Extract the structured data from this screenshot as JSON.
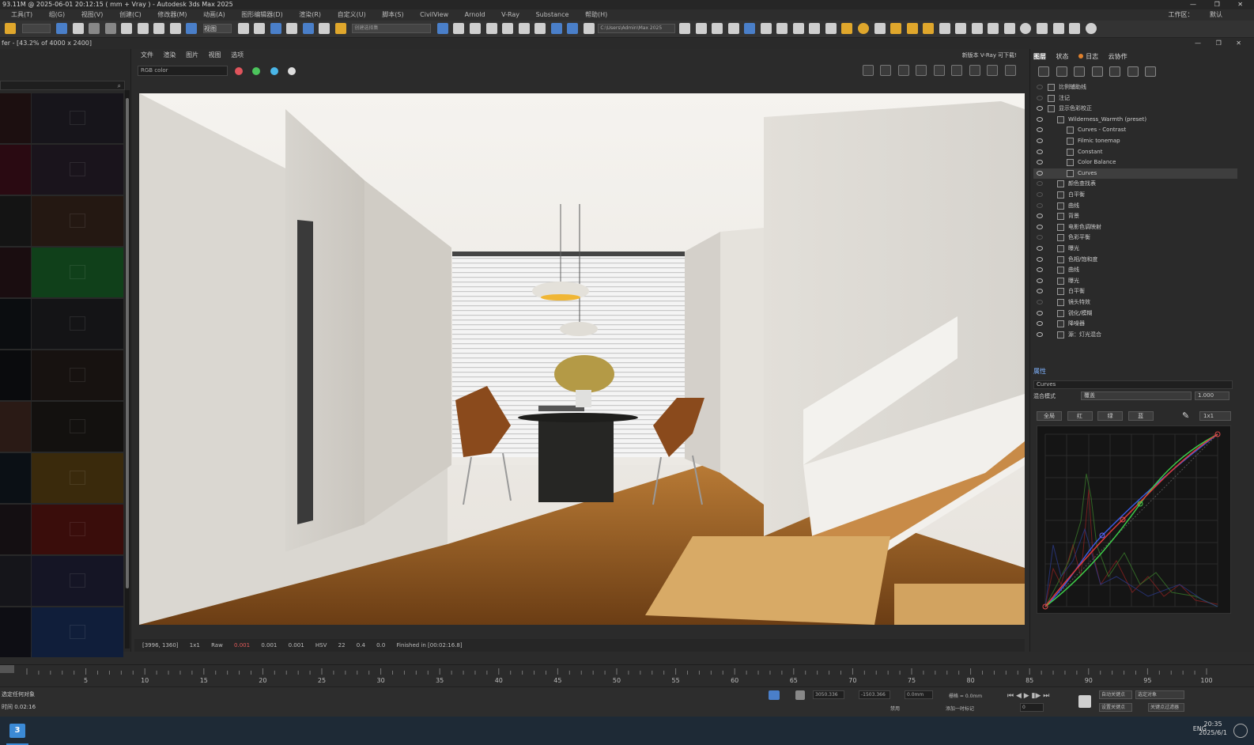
{
  "title": "93.11M @ 2025-06-01 20:12:15  ( mm + Vray ) - Autodesk 3ds Max 2025",
  "window_controls": "—  ❐  ✕",
  "menu": [
    "工具(T)",
    "组(G)",
    "视图(V)",
    "创建(C)",
    "修改器(M)",
    "动画(A)",
    "图形编辑器(D)",
    "渲染(R)",
    "自定义(U)",
    "脚本(S)",
    "CivilView",
    "Arnold",
    "V-Ray",
    "Substance",
    "帮助(H)"
  ],
  "menu_right": [
    "工作区：",
    "默认"
  ],
  "toolbar": {
    "view_dropdown": "视图",
    "selection_set": "创建选择集",
    "path": "C:\\Users\\Admin\\Max 2025"
  },
  "framebuffer_title": "fer - [43.2% of 4000 x 2400]",
  "framebuffer_window_controls": "—  ❐  ✕",
  "history_swatches": [
    {
      "a": "#1c0f10",
      "b": "#17151b"
    },
    {
      "a": "#2a0a12",
      "b": "#1a141c"
    },
    {
      "a": "#141414",
      "b": "#241812"
    },
    {
      "a": "#1a0d10",
      "b": "#10401a"
    },
    {
      "a": "#0b0d10",
      "b": "#141416"
    },
    {
      "a": "#0a0b0d",
      "b": "#171210"
    },
    {
      "a": "#2a1a15",
      "b": "#13110f"
    },
    {
      "a": "#0b1015",
      "b": "#3a2a0c"
    },
    {
      "a": "#140f12",
      "b": "#3a0d0b"
    },
    {
      "a": "#15151a",
      "b": "#151525"
    },
    {
      "a": "#0e0e14",
      "b": "#101e3a"
    }
  ],
  "vp_menu": [
    "文件",
    "渲染",
    "图片",
    "视图",
    "选项"
  ],
  "channel": "RGB color",
  "channel_dots": [
    "#e0545c",
    "#4cc45c",
    "#4ab6e8"
  ],
  "new_version": "新版本 V-Ray 可下载!",
  "status": {
    "coords": "[3996, 1360]",
    "zoom": "1x1",
    "raw": "Raw",
    "r": "0.001",
    "g": "0.001",
    "b": "0.001",
    "mode": "HSV",
    "h": "22",
    "s": "0.4",
    "v": "0.0",
    "finished": "Finished in [00:02:16.8]"
  },
  "right_tabs": [
    "图层",
    "状态",
    "日志",
    "云协作"
  ],
  "layers": [
    {
      "label": "比例辅助线",
      "indent": 0,
      "visible": false,
      "selected": false
    },
    {
      "label": "注记",
      "indent": 0,
      "visible": false,
      "selected": false
    },
    {
      "label": "显示色彩校正",
      "indent": 0,
      "visible": true,
      "selected": false
    },
    {
      "label": "Wilderness_Warmth (preset)",
      "indent": 1,
      "visible": true,
      "selected": false
    },
    {
      "label": "Curves - Contrast",
      "indent": 2,
      "visible": true,
      "selected": false
    },
    {
      "label": "Filmic tonemap",
      "indent": 2,
      "visible": true,
      "selected": false
    },
    {
      "label": "Constant",
      "indent": 2,
      "visible": true,
      "selected": false
    },
    {
      "label": "Color Balance",
      "indent": 2,
      "visible": true,
      "selected": false
    },
    {
      "label": "Curves",
      "indent": 2,
      "visible": true,
      "selected": true
    },
    {
      "label": "颜色查找表",
      "indent": 1,
      "visible": false,
      "selected": false
    },
    {
      "label": "白平衡",
      "indent": 1,
      "visible": false,
      "selected": false
    },
    {
      "label": "曲线",
      "indent": 1,
      "visible": false,
      "selected": false
    },
    {
      "label": "背景",
      "indent": 1,
      "visible": true,
      "selected": false
    },
    {
      "label": "电影色调映射",
      "indent": 1,
      "visible": true,
      "selected": false
    },
    {
      "label": "色彩平衡",
      "indent": 1,
      "visible": false,
      "selected": false
    },
    {
      "label": "曝光",
      "indent": 1,
      "visible": true,
      "selected": false
    },
    {
      "label": "色相/饱和度",
      "indent": 1,
      "visible": true,
      "selected": false
    },
    {
      "label": "曲线",
      "indent": 1,
      "visible": true,
      "selected": false
    },
    {
      "label": "曝光",
      "indent": 1,
      "visible": true,
      "selected": false
    },
    {
      "label": "白平衡",
      "indent": 1,
      "visible": true,
      "selected": false
    },
    {
      "label": "镜头特效",
      "indent": 1,
      "visible": false,
      "selected": false
    },
    {
      "label": "锐化/模糊",
      "indent": 1,
      "visible": true,
      "selected": false
    },
    {
      "label": "降噪器",
      "indent": 1,
      "visible": true,
      "selected": false
    },
    {
      "label": "源：灯光混合",
      "indent": 1,
      "visible": true,
      "selected": false
    }
  ],
  "properties": {
    "header": "属性",
    "name": "Curves",
    "blend_label": "混合模式",
    "blend_value": "覆盖",
    "opacity": "1.000",
    "channel_buttons": [
      "全局",
      "红",
      "绿",
      "蓝"
    ],
    "zoom": "1x1"
  },
  "timeline_ticks": [
    "5",
    "10",
    "15",
    "20",
    "25",
    "30",
    "35",
    "40",
    "45",
    "50",
    "55",
    "60",
    "65",
    "70",
    "75",
    "80",
    "85",
    "90",
    "95",
    "100"
  ],
  "bottom": {
    "status1": "选定任何对象",
    "status2": "时间  0.02:16",
    "x": "3050.336",
    "y": "-1503.366",
    "z": "0.0mm",
    "grid": "栅格 = 0.0mm",
    "enable": "禁用",
    "add_tag": "添加一时标记",
    "auto_key": "自动关键点",
    "set_key": "设置关键点",
    "selected": "选定对象",
    "key_filter": "关键点过滤器",
    "frame": "0"
  },
  "taskbar": {
    "start": "3",
    "lang": "ENG",
    "time": "20:35",
    "date": "2025/6/1"
  },
  "colors": {
    "accent": "#3b8ad6",
    "curve_red": "#e03a3a",
    "curve_green": "#3ed04a",
    "curve_blue": "#3a5ae0"
  }
}
